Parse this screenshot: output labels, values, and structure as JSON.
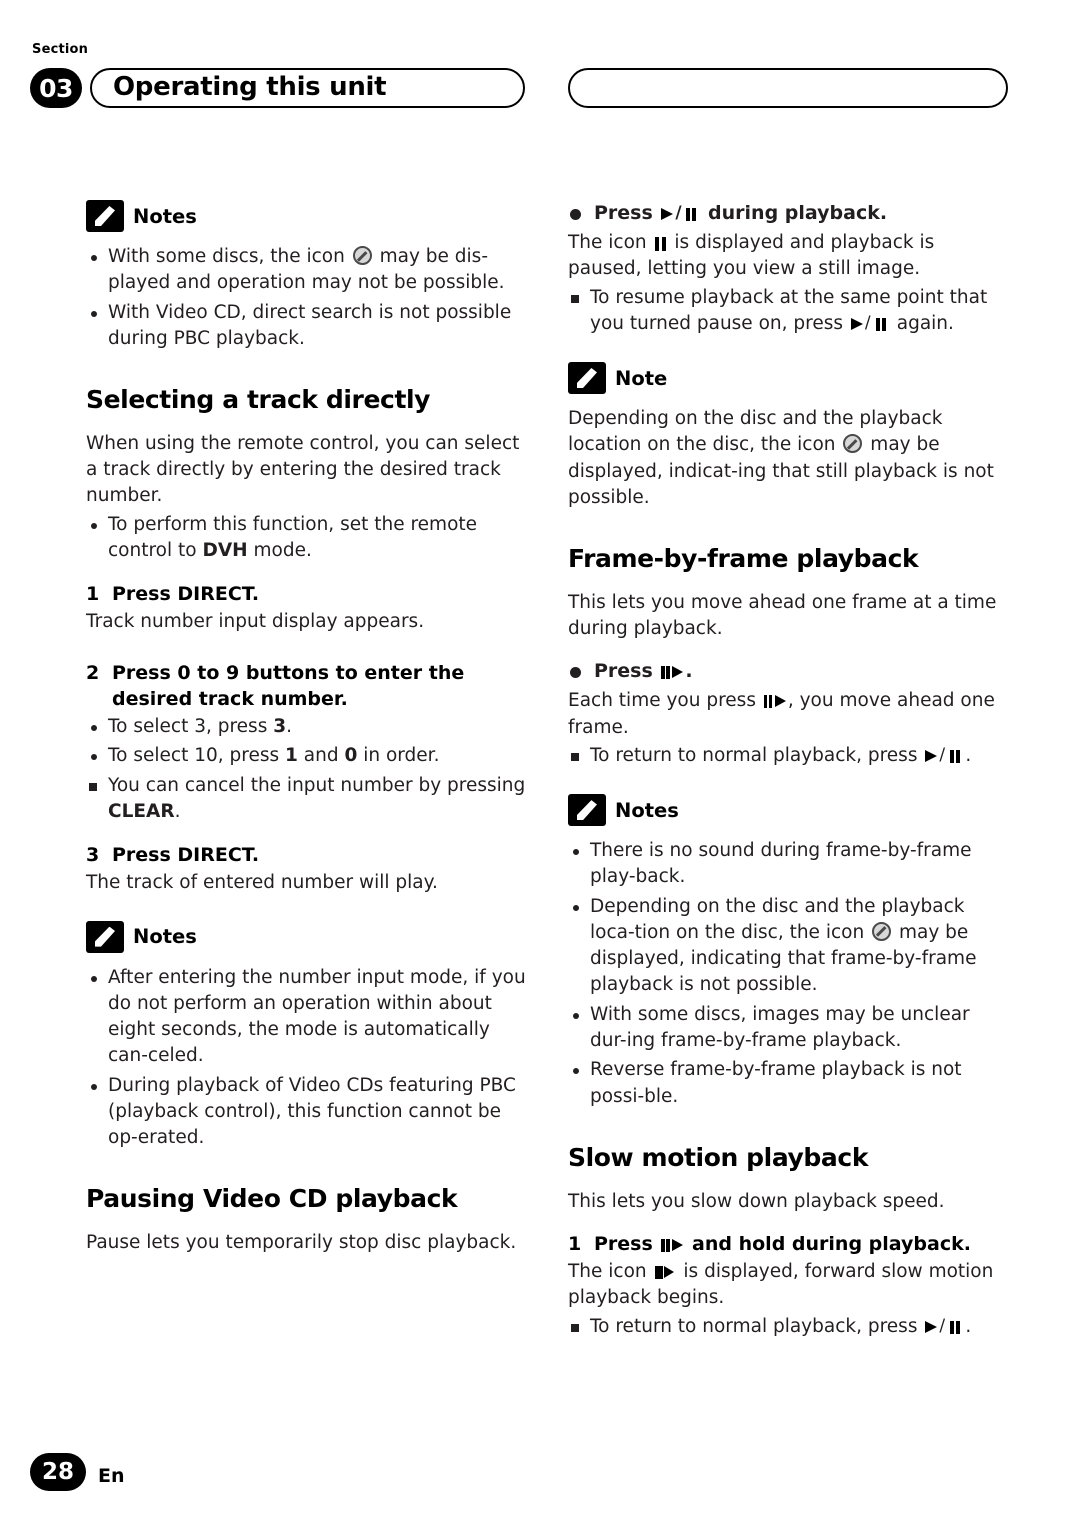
{
  "header": {
    "section_label": "Section",
    "section_number": "03",
    "title": "Operating this unit"
  },
  "footer": {
    "page_number": "28",
    "language": "En"
  },
  "left_column": {
    "notes_1": {
      "title": "Notes",
      "items": [
        "With some discs, the icon  may be dis-played and operation may not be possible.",
        "With Video CD, direct search is not possible during PBC playback."
      ],
      "item1_pre": "With some discs, the icon",
      "item1_post": "may be dis-played and operation may not be possible.",
      "item2": "With Video CD, direct search is not possible during PBC playback."
    },
    "heading_selecting": "Selecting a track directly",
    "selecting_body": "When using the remote control, you can select a track directly by entering the desired track number.",
    "selecting_bullet_pre": "To perform this function, set the remote control to ",
    "selecting_bullet_bold": "DVH",
    "selecting_bullet_post": " mode.",
    "step1_num": "1",
    "step1_text": "Press DIRECT.",
    "step1_body": "Track number input display appears.",
    "step2_num": "2",
    "step2_text": "Press 0 to 9 buttons to enter the desired track number.",
    "step2_bullet1_pre": "To select 3, press ",
    "step2_bullet1_bold": "3",
    "step2_bullet1_post": ".",
    "step2_bullet2_pre": "To select 10, press ",
    "step2_bullet2_bold1": "1",
    "step2_bullet2_mid": " and ",
    "step2_bullet2_bold2": "0",
    "step2_bullet2_post": " in order.",
    "step2_square_pre": "You can cancel the input number by pressing ",
    "step2_square_bold": "CLEAR",
    "step2_square_post": ".",
    "step3_num": "3",
    "step3_text": "Press DIRECT.",
    "step3_body": "The track of entered number will play.",
    "notes_2": {
      "title": "Notes",
      "item1": "After entering the number input mode, if you do not perform an operation within about eight seconds, the mode is automatically can-celed.",
      "item2": "During playback of Video CDs featuring PBC (playback control), this function cannot be op-erated."
    },
    "heading_pausing": "Pausing Video CD playback",
    "pausing_body": "Pause lets you temporarily stop disc playback."
  },
  "right_column": {
    "press_playpause_pre": "Press ",
    "press_playpause_post": " during playback.",
    "press_playpause_body_pre": "The icon ",
    "press_playpause_body_post": " is displayed and playback is paused, letting you view a still image.",
    "resume_pre": "To resume playback at the same point that you turned pause on, press ",
    "resume_post": " again.",
    "note_1": {
      "title": "Note",
      "body_pre": "Depending on the disc and the playback location on the disc, the icon",
      "body_post": "may be displayed, indicat-ing that still playback is not possible."
    },
    "heading_frame": "Frame-by-frame playback",
    "frame_body": "This lets you move ahead one frame at a time during playback.",
    "press_frame_pre": "Press ",
    "press_frame_post": ".",
    "frame_detail_pre": "Each time you press ",
    "frame_detail_post": ", you move ahead one frame.",
    "frame_return_pre": "To return to normal playback, press ",
    "frame_return_post": ".",
    "notes_2": {
      "title": "Notes",
      "item1": "There is no sound during frame-by-frame play-back.",
      "item2_pre": "Depending on the disc and the playback loca-tion on the disc, the icon",
      "item2_post": "may be displayed, indicating that frame-by-frame playback is not possible.",
      "item3": "With some discs, images may be unclear dur-ing frame-by-frame playback.",
      "item4": "Reverse frame-by-frame playback is not possi-ble."
    },
    "heading_slow": "Slow motion playback",
    "slow_body": "This lets you slow down playback speed.",
    "slow_step_num": "1",
    "slow_step_pre": "Press ",
    "slow_step_post": " and hold during playback.",
    "slow_detail_pre": "The icon ",
    "slow_detail_post": " is displayed, forward slow motion playback begins.",
    "slow_return_pre": "To return to normal playback, press ",
    "slow_return_post": "."
  }
}
